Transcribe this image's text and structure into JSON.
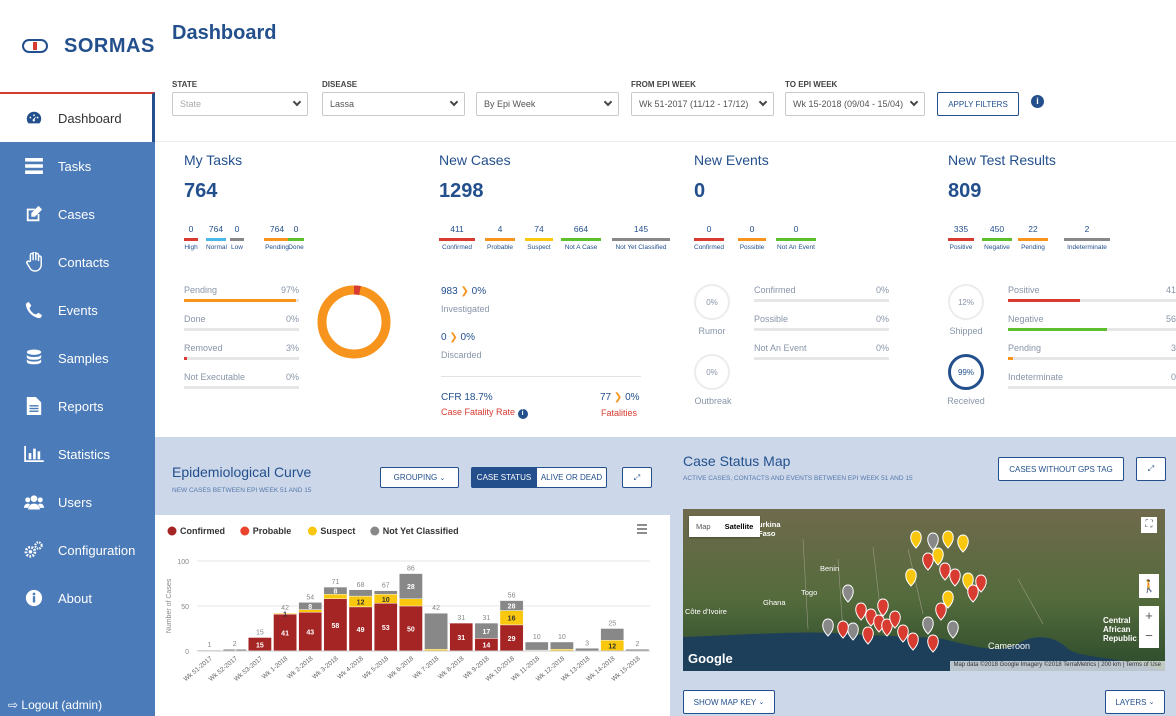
{
  "brand": {
    "name": "SORMAS"
  },
  "nav": [
    {
      "label": "Dashboard",
      "icon": "dashboard-icon"
    },
    {
      "label": "Tasks",
      "icon": "tasks-icon"
    },
    {
      "label": "Cases",
      "icon": "edit-icon"
    },
    {
      "label": "Contacts",
      "icon": "hand-icon"
    },
    {
      "label": "Events",
      "icon": "phone-icon"
    },
    {
      "label": "Samples",
      "icon": "database-icon"
    },
    {
      "label": "Reports",
      "icon": "file-icon"
    },
    {
      "label": "Statistics",
      "icon": "bar-chart-icon"
    },
    {
      "label": "Users",
      "icon": "users-icon"
    },
    {
      "label": "Configuration",
      "icon": "gears-icon"
    },
    {
      "label": "About",
      "icon": "info-icon"
    }
  ],
  "logout": "Logout (admin)",
  "page": {
    "title": "Dashboard"
  },
  "filters": {
    "state_label": "STATE",
    "state_placeholder": "State",
    "disease_label": "DISEASE",
    "disease_value": "Lassa",
    "grouping_value": "By Epi Week",
    "from_label": "FROM EPI WEEK",
    "from_value": "Wk 51-2017 (11/12 - 17/12)",
    "to_label": "TO EPI WEEK",
    "to_value": "Wk 15-2018 (09/04 - 15/04)",
    "apply": "APPLY FILTERS"
  },
  "tasks": {
    "title": "My Tasks",
    "total": "764",
    "breakdown": [
      {
        "value": "0",
        "label": "High",
        "color": "#d83b2f"
      },
      {
        "value": "764",
        "label": "Normal",
        "color": "#4ab8e8"
      },
      {
        "value": "0",
        "label": "Low",
        "color": "#888888"
      },
      {
        "value": "764",
        "label": "Pending",
        "color": "#f7941d"
      },
      {
        "value": "0",
        "label": "Done",
        "color": "#5bbf2e"
      }
    ],
    "rows": [
      {
        "label": "Pending",
        "pct": "97%",
        "fill": 0.97,
        "color": "#f7941d"
      },
      {
        "label": "Done",
        "pct": "0%",
        "fill": 0,
        "color": "#5bbf2e"
      },
      {
        "label": "Removed",
        "pct": "3%",
        "fill": 0.03,
        "color": "#d83b2f"
      },
      {
        "label": "Not Executable",
        "pct": "0%",
        "fill": 0,
        "color": "#888888"
      }
    ]
  },
  "cases": {
    "title": "New Cases",
    "total": "1298",
    "breakdown": [
      {
        "value": "411",
        "label": "Confirmed",
        "color": "#d83b2f"
      },
      {
        "value": "4",
        "label": "Probable",
        "color": "#f7941d"
      },
      {
        "value": "74",
        "label": "Suspect",
        "color": "#f9c80e"
      },
      {
        "value": "664",
        "label": "Not A Case",
        "color": "#5bbf2e"
      },
      {
        "value": "145",
        "label": "Not Yet Classified",
        "color": "#888888"
      }
    ],
    "investigated_value": "983",
    "investigated_pct": "0%",
    "investigated_label": "Investigated",
    "discarded_value": "0",
    "discarded_pct": "0%",
    "discarded_label": "Discarded",
    "cfr": "CFR 18.7%",
    "cfr_label": "Case Fatality Rate",
    "fatalities_value": "77",
    "fatalities_pct": "0%",
    "fatalities_label": "Fatalities"
  },
  "events": {
    "title": "New Events",
    "total": "0",
    "breakdown": [
      {
        "value": "0",
        "label": "Confirmed",
        "color": "#d83b2f"
      },
      {
        "value": "0",
        "label": "Possible",
        "color": "#f7941d"
      },
      {
        "value": "0",
        "label": "Not An Event",
        "color": "#5bbf2e"
      }
    ],
    "rumor_pct": "0%",
    "rumor_label": "Rumor",
    "outbreak_pct": "0%",
    "outbreak_label": "Outbreak",
    "rows": [
      {
        "label": "Confirmed",
        "pct": "0%"
      },
      {
        "label": "Possible",
        "pct": "0%"
      },
      {
        "label": "Not An Event",
        "pct": "0%"
      }
    ]
  },
  "tests": {
    "title": "New Test Results",
    "total": "809",
    "breakdown": [
      {
        "value": "335",
        "label": "Positive",
        "color": "#d83b2f"
      },
      {
        "value": "450",
        "label": "Negative",
        "color": "#5bbf2e"
      },
      {
        "value": "22",
        "label": "Pending",
        "color": "#f7941d"
      },
      {
        "value": "2",
        "label": "Indeterminate",
        "color": "#888888"
      }
    ],
    "shipped_pct": "12%",
    "shipped_label": "Shipped",
    "received_pct": "99%",
    "received_label": "Received",
    "rows": [
      {
        "label": "Positive",
        "pct": "41%",
        "fill": 0.41,
        "color": "#d83b2f"
      },
      {
        "label": "Negative",
        "pct": "56%",
        "fill": 0.56,
        "color": "#5bbf2e"
      },
      {
        "label": "Pending",
        "pct": "3%",
        "fill": 0.03,
        "color": "#f7941d"
      },
      {
        "label": "Indeterminate",
        "pct": "0%",
        "fill": 0,
        "color": "#888888"
      }
    ]
  },
  "epi": {
    "title": "Epidemiological Curve",
    "subtitle": "NEW CASES BETWEEN EPI WEEK 51 AND 15",
    "grouping": "GROUPING",
    "case_status": "CASE STATUS",
    "alive_or_dead": "ALIVE OR DEAD"
  },
  "map": {
    "title": "Case Status Map",
    "subtitle": "ACTIVE CASES, CONTACTS AND EVENTS BETWEEN EPI WEEK 51 AND 15",
    "no_gps": "CASES WITHOUT GPS TAG",
    "map_type": "Map",
    "satellite": "Satellite",
    "places": [
      "urkina Faso",
      "Benin",
      "Togo",
      "Ghana",
      "Côte d'Ivoire",
      "Cameroon",
      "Central African Republic"
    ],
    "google": "Google",
    "attribution": "Map data ©2018 Google Imagery ©2018 TerraMetrics | 200 km | Terms of Use",
    "show_key": "SHOW MAP KEY",
    "layers": "LAYERS"
  },
  "chart_data": {
    "type": "bar",
    "stacked": true,
    "ylabel": "Number of Cases",
    "ylim": [
      0,
      100
    ],
    "yticks": [
      0,
      50,
      100
    ],
    "legend_position": "top-left",
    "categories": [
      "Wk 51-2017",
      "Wk 52-2017",
      "Wk 53-2017",
      "Wk 1-2018",
      "Wk 2-2018",
      "Wk 3-2018",
      "Wk 4-2018",
      "Wk 5-2018",
      "Wk 6-2018",
      "Wk 7-2018",
      "Wk 8-2018",
      "Wk 9-2018",
      "Wk 10-2018",
      "Wk 11-2018",
      "Wk 12-2018",
      "Wk 13-2018",
      "Wk 14-2018",
      "Wk 15-2018"
    ],
    "totals": [
      1,
      2,
      15,
      42,
      54,
      71,
      68,
      67,
      86,
      42,
      31,
      31,
      56,
      10,
      10,
      3,
      25,
      2
    ],
    "series": [
      {
        "name": "Confirmed",
        "color": "#a52424",
        "values": [
          0,
          0,
          15,
          41,
          43,
          58,
          49,
          53,
          50,
          0,
          31,
          14,
          29,
          0,
          0,
          0,
          0,
          0
        ],
        "labels": [
          "",
          "",
          "15",
          "41",
          "43",
          "58",
          "49",
          "53",
          "50",
          "",
          "31",
          "14",
          "29",
          "",
          "",
          "",
          "",
          ""
        ]
      },
      {
        "name": "Probable",
        "color": "#e8452c",
        "values": [
          0,
          0,
          0,
          0,
          0,
          0,
          0,
          0,
          0,
          0,
          0,
          0,
          0,
          0,
          0,
          0,
          0,
          0
        ],
        "labels": [
          "",
          "",
          "",
          "",
          "",
          "",
          "",
          "",
          "",
          "",
          "",
          "",
          "",
          "",
          "",
          "",
          "",
          ""
        ]
      },
      {
        "name": "Suspect",
        "color": "#f9c80e",
        "values": [
          0,
          0,
          0,
          1,
          3,
          5,
          12,
          10,
          8,
          2,
          0,
          0,
          16,
          1,
          2,
          0,
          12,
          0
        ],
        "labels": [
          "",
          "",
          "",
          "1",
          "",
          "",
          "12",
          "10",
          "",
          "",
          "",
          "",
          "16",
          "",
          "",
          "",
          "12",
          ""
        ]
      },
      {
        "name": "Not Yet Classified",
        "color": "#888888",
        "values": [
          1,
          2,
          0,
          0,
          8,
          8,
          7,
          4,
          28,
          40,
          0,
          17,
          11,
          9,
          8,
          3,
          13,
          2
        ],
        "labels": [
          "1",
          "2",
          "",
          "",
          "8",
          "8",
          "",
          "",
          "28",
          "",
          "",
          "17",
          "28",
          "",
          "",
          "",
          "",
          ""
        ]
      }
    ]
  }
}
